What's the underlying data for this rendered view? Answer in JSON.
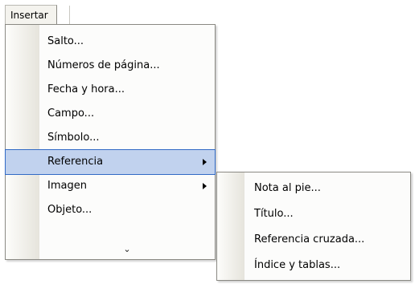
{
  "menubar": {
    "title": "Insertar"
  },
  "dropdown": {
    "items": [
      {
        "label": "Salto...",
        "has_submenu": false
      },
      {
        "label": "Números de página...",
        "has_submenu": false
      },
      {
        "label": "Fecha y hora...",
        "has_submenu": false
      },
      {
        "label": "Campo...",
        "has_submenu": false
      },
      {
        "label": "Símbolo...",
        "has_submenu": false
      },
      {
        "label": "Referencia",
        "has_submenu": true,
        "active": true
      },
      {
        "label": "Imagen",
        "has_submenu": true
      },
      {
        "label": "Objeto...",
        "has_submenu": false
      }
    ],
    "expand_glyph": "⌄"
  },
  "submenu": {
    "items": [
      {
        "label": "Nota al pie..."
      },
      {
        "label": "Título..."
      },
      {
        "label": "Referencia cruzada..."
      },
      {
        "label": "Índice y tablas..."
      }
    ]
  },
  "colors": {
    "highlight_fill": "#c1d2ee",
    "highlight_border": "#316ac5",
    "menu_border": "#8a8983"
  }
}
